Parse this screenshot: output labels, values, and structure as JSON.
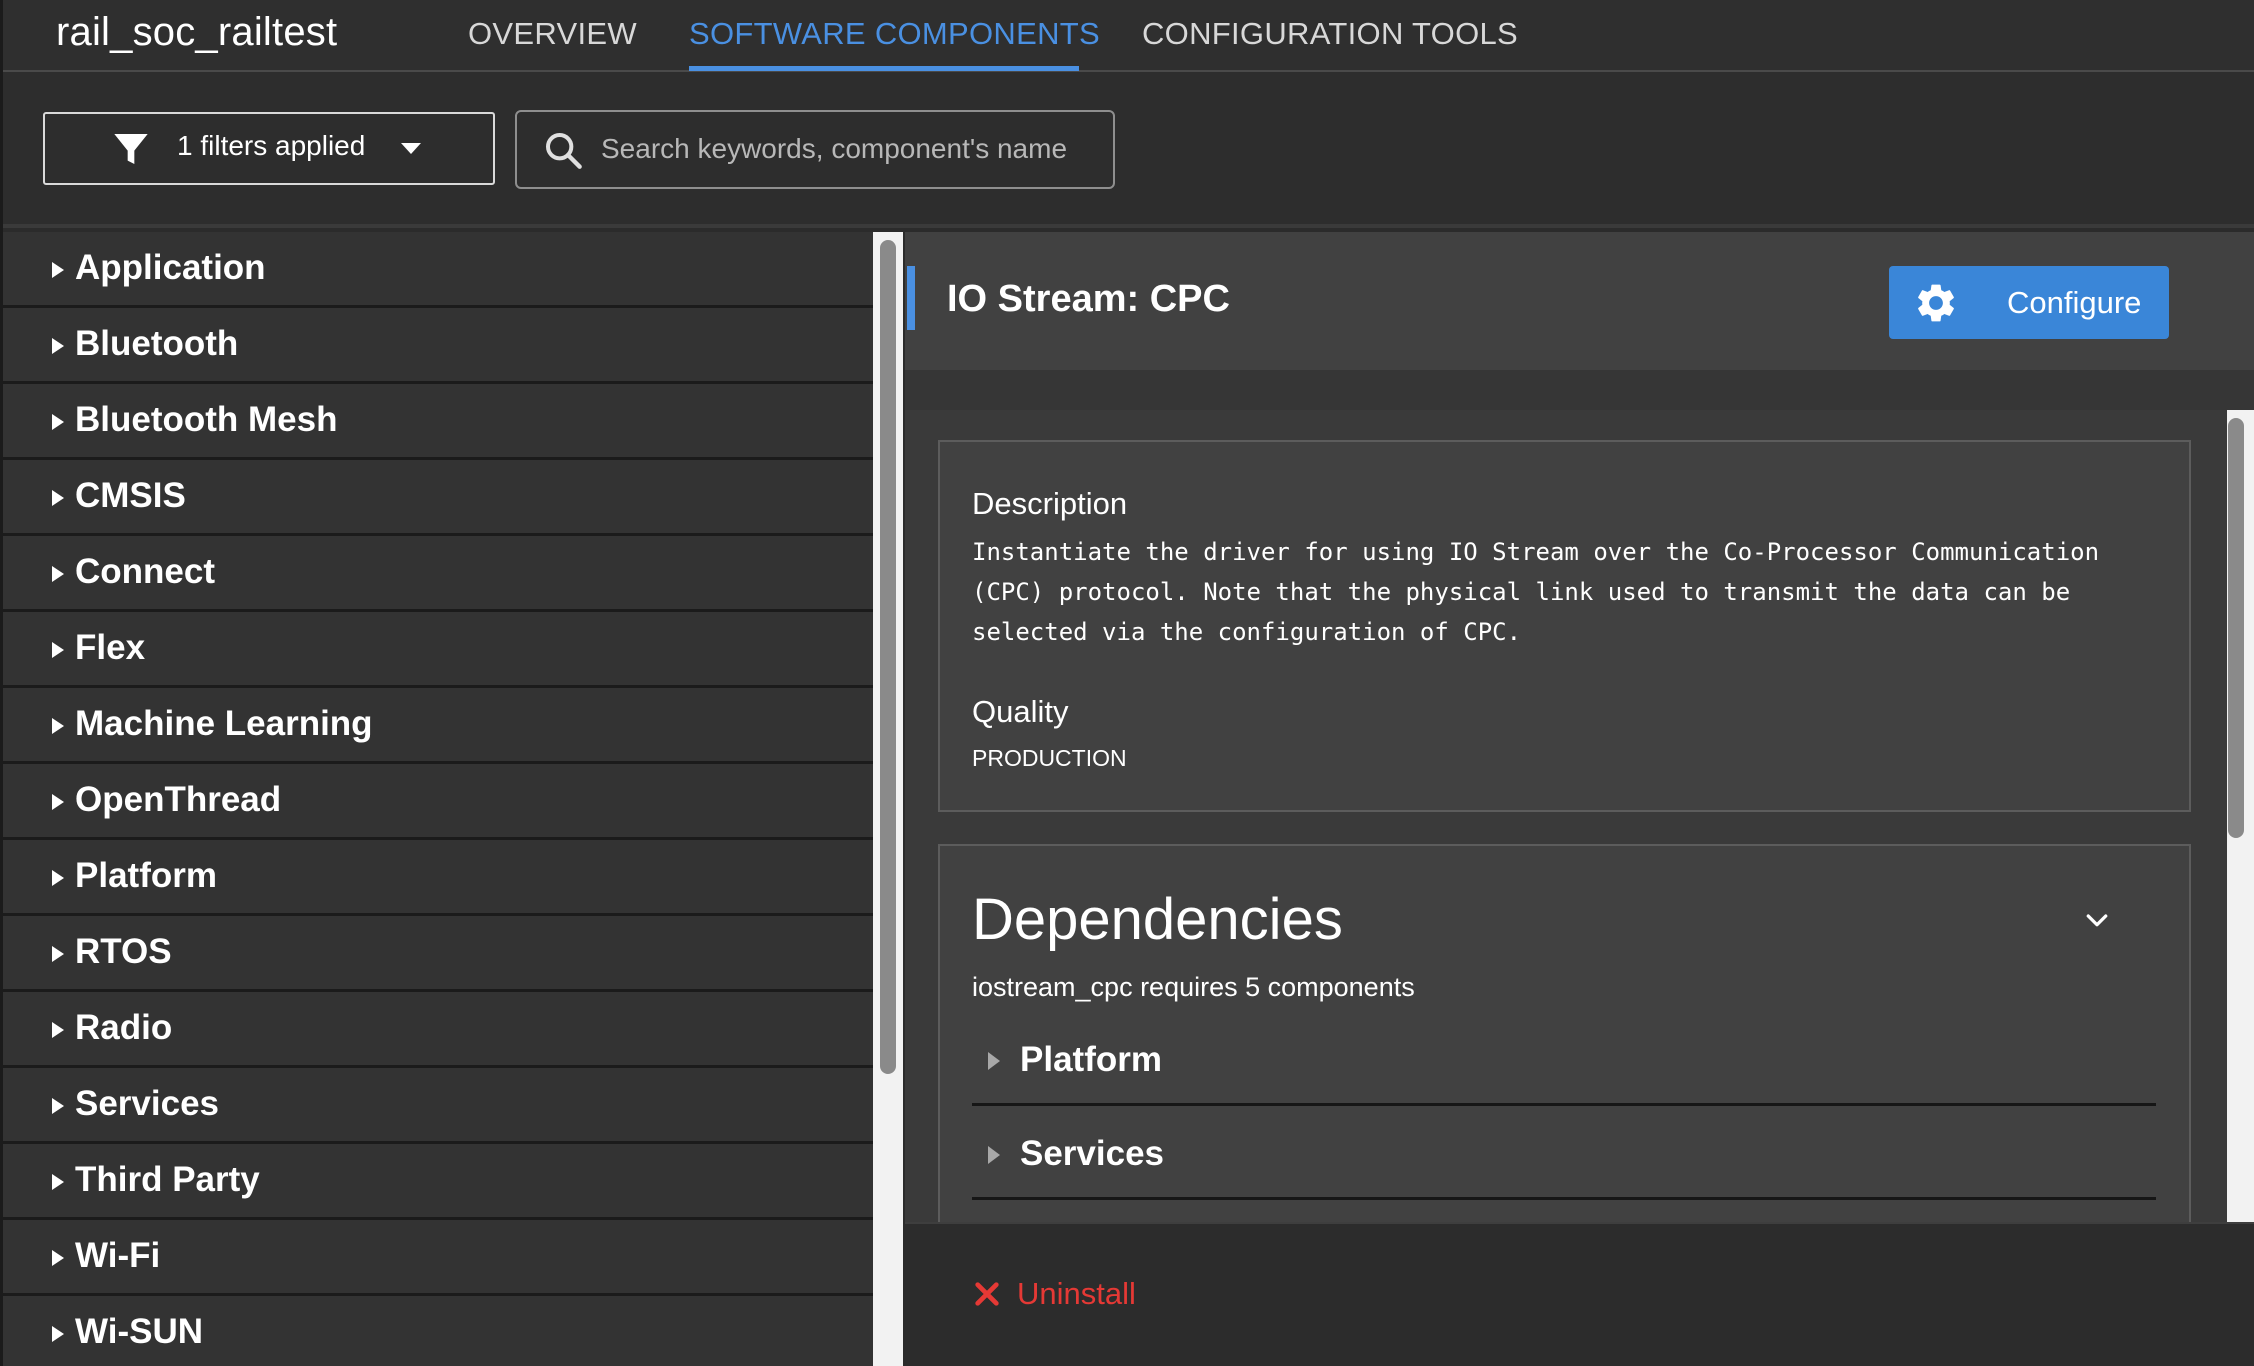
{
  "app": {
    "title": "rail_soc_railtest"
  },
  "tabs": [
    {
      "label": "OVERVIEW",
      "active": false
    },
    {
      "label": "SOFTWARE COMPONENTS",
      "active": true
    },
    {
      "label": "CONFIGURATION TOOLS",
      "active": false
    }
  ],
  "filters": {
    "button_label": "1 filters applied",
    "icon": "filter-icon"
  },
  "search": {
    "placeholder": "Search keywords, component's name",
    "value": "",
    "icon": "search-icon"
  },
  "categories": [
    {
      "label": "Application"
    },
    {
      "label": "Bluetooth"
    },
    {
      "label": "Bluetooth Mesh"
    },
    {
      "label": "CMSIS"
    },
    {
      "label": "Connect"
    },
    {
      "label": "Flex"
    },
    {
      "label": "Machine Learning"
    },
    {
      "label": "OpenThread"
    },
    {
      "label": "Platform"
    },
    {
      "label": "RTOS"
    },
    {
      "label": "Radio"
    },
    {
      "label": "Services"
    },
    {
      "label": "Third Party"
    },
    {
      "label": "Wi-Fi"
    },
    {
      "label": "Wi-SUN"
    }
  ],
  "detail": {
    "title": "IO Stream: CPC",
    "configure_label": "Configure",
    "configure_icon": "gear-icon",
    "description_heading": "Description",
    "description_text": "Instantiate the driver for using IO Stream over the Co-Processor Communication\n(CPC) protocol. Note that the physical link used to transmit the data can be\nselected via the configuration of CPC.",
    "quality_heading": "Quality",
    "quality_value": "PRODUCTION",
    "dependencies": {
      "heading": "Dependencies",
      "summary": "iostream_cpc requires 5 components",
      "groups": [
        {
          "label": "Platform"
        },
        {
          "label": "Services"
        }
      ]
    },
    "uninstall_label": "Uninstall",
    "uninstall_icon": "close-icon"
  },
  "colors": {
    "accent": "#4a90e2",
    "configure_button": "#3a86d8",
    "uninstall": "#e53935",
    "background": "#2b2b2b"
  }
}
